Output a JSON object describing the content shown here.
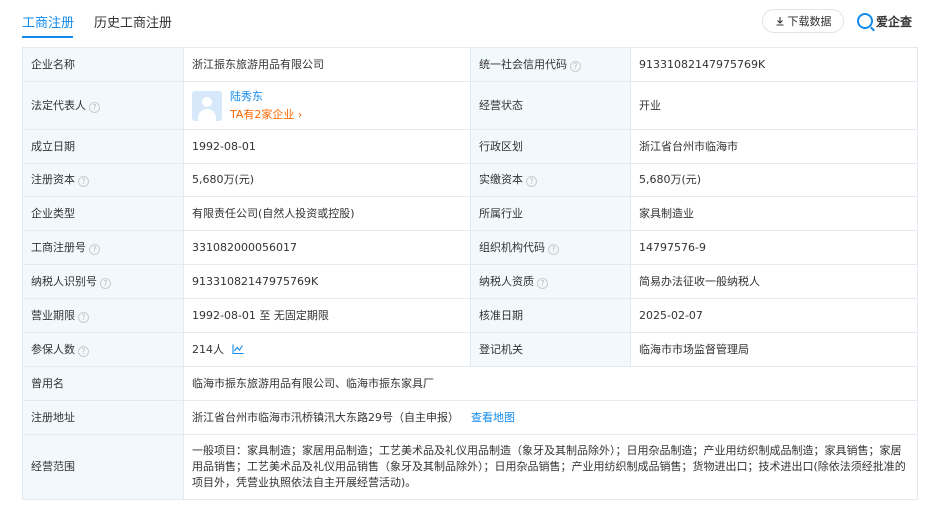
{
  "tabs": {
    "active": "工商注册",
    "history": "历史工商注册"
  },
  "toolbar": {
    "download_label": "下载数据",
    "download_icon": "download-arrow-icon"
  },
  "brand": {
    "name": "爱企查",
    "color": "#128bed"
  },
  "colors": {
    "accent": "#128bed",
    "label_bg": "#f2f9fc",
    "border": "#e4eaf0",
    "link_orange": "#ff6600"
  },
  "help_glyph": "?",
  "table": {
    "company_name": {
      "label": "企业名称",
      "value": "浙江振东旅游用品有限公司"
    },
    "credit_code": {
      "label": "统一社会信用代码",
      "value": "91331082147975769K"
    },
    "legal_rep": {
      "label": "法定代表人",
      "name": "陆秀东",
      "companies": "TA有2家企业 ›"
    },
    "status": {
      "label": "经营状态",
      "value": "开业"
    },
    "founded": {
      "label": "成立日期",
      "value": "1992-08-01"
    },
    "region": {
      "label": "行政区划",
      "value": "浙江省台州市临海市"
    },
    "reg_capital": {
      "label": "注册资本",
      "value": "5,680万(元)"
    },
    "paid_capital": {
      "label": "实缴资本",
      "value": "5,680万(元)"
    },
    "company_type": {
      "label": "企业类型",
      "value": "有限责任公司(自然人投资或控股)"
    },
    "industry": {
      "label": "所属行业",
      "value": "家具制造业"
    },
    "reg_number": {
      "label": "工商注册号",
      "value": "331082000056017"
    },
    "org_code": {
      "label": "组织机构代码",
      "value": "14797576-9"
    },
    "tax_id": {
      "label": "纳税人识别号",
      "value": "91331082147975769K"
    },
    "tax_qualification": {
      "label": "纳税人资质",
      "value": "简易办法征收一般纳税人"
    },
    "term": {
      "label": "营业期限",
      "value": "1992-08-01 至 无固定期限"
    },
    "approval_date": {
      "label": "核准日期",
      "value": "2025-02-07"
    },
    "insured": {
      "label": "参保人数",
      "value": "214人"
    },
    "authority": {
      "label": "登记机关",
      "value": "临海市市场监督管理局"
    },
    "former_names": {
      "label": "曾用名",
      "value": "临海市振东旅游用品有限公司、临海市振东家具厂"
    },
    "address": {
      "label": "注册地址",
      "value": "浙江省台州市临海市汛桥镇汛大东路29号（自主申报）",
      "map_link": "查看地图"
    },
    "scope": {
      "label": "经营范围",
      "value": "一般项目：家具制造；家居用品制造；工艺美术品及礼仪用品制造（象牙及其制品除外）；日用杂品制造；产业用纺织制成品制造；家具销售；家居用品销售；工艺美术品及礼仪用品销售（象牙及其制品除外）；日用杂品销售；产业用纺织制成品销售；货物进出口；技术进出口(除依法须经批准的项目外，凭营业执照依法自主开展经营活动)。"
    }
  }
}
